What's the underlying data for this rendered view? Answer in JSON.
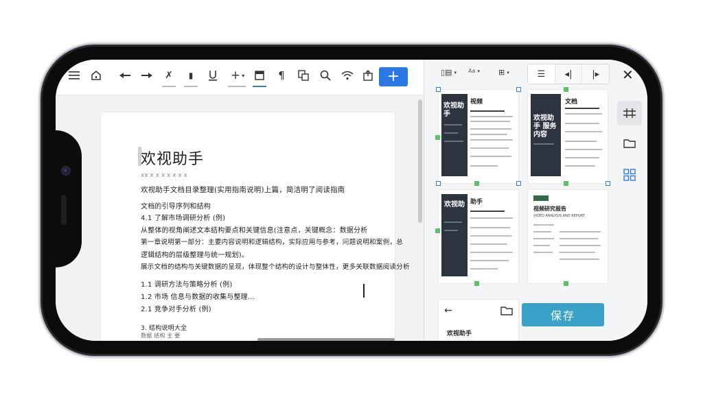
{
  "document": {
    "title": "欢视助手",
    "subtitle": "xx x x x x x x x",
    "lines": [
      "欢视助手文档目录整理(实用指南说明)上篇，简洁明了阅读指南",
      "文档的引导序列和结构",
      "4.1 了解市场调研分析 (例)",
      "从整体的视角阐述文本结构要点和关键信息(注意点，关键概念：数据分析",
      "第一章说明第一部分：主要内容说明和逻辑结构，实际应用与参考，问题说明和案例，总",
      "逻辑结构的层级整理与统一规划)。",
      "展示文档的结构与关键数据的呈现，体现整个结构的设计与整体性，更多关联数据阅读分析"
    ],
    "list_lines": [
      "1.1 调研方法与策略分析 (例)",
      "1.2 市场 信息与数据的收集与整理...",
      "2.1 竞争对手分析 (例)"
    ],
    "footer_line": "3. 结构说明大全",
    "footer_sub": "数据 结构 主 要"
  },
  "toolbar": {
    "add_label": "+"
  },
  "right_panel": {
    "top_label_a": "目录",
    "top_label_b": "Aa",
    "save_label": "保存",
    "thumb1": {
      "title_dark": "欢视助手",
      "title": "视频"
    },
    "thumb2": {
      "title_dark": "欢视助手 服务内容",
      "title": "文档"
    },
    "thumb3": {
      "title_dark": "欢视助",
      "title": "助手"
    },
    "thumb4": {
      "title": "视频研究报告",
      "sub": "VIDEO ANALYSIS AND REPORT"
    },
    "bottom_card_text": "欢视助手"
  },
  "colors": {
    "accent_blue": "#2b78e4",
    "save_button": "#3aa2c9",
    "dark_cover": "#2c3440",
    "marker_green": "#5ec06b"
  }
}
